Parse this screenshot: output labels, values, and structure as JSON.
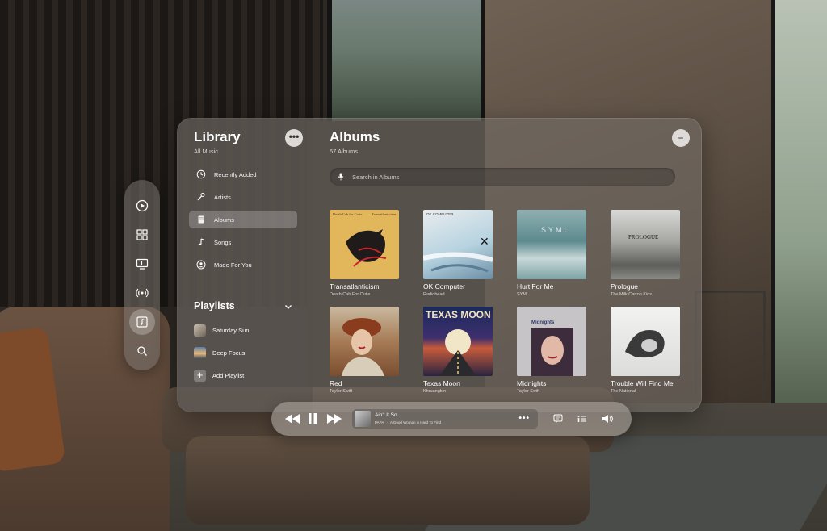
{
  "library": {
    "title": "Library",
    "subtitle": "All Music",
    "nav": [
      {
        "label": "Recently Added",
        "icon": "clock-icon"
      },
      {
        "label": "Artists",
        "icon": "microphone-icon"
      },
      {
        "label": "Albums",
        "icon": "album-icon",
        "active": true
      },
      {
        "label": "Songs",
        "icon": "music-note-icon"
      },
      {
        "label": "Made For You",
        "icon": "person-circle-icon"
      }
    ]
  },
  "playlists": {
    "title": "Playlists",
    "items": [
      {
        "label": "Saturday Sun"
      },
      {
        "label": "Deep Focus"
      },
      {
        "label": "Add Playlist"
      }
    ]
  },
  "albums": {
    "title": "Albums",
    "count": "57 Albums",
    "search_placeholder": "Search in Albums",
    "items": [
      {
        "title": "Transatlanticism",
        "artist": "Death Cab For Cutie",
        "cover_text": "Death Cab for Cutie",
        "cover_text2": "Transatlanticism"
      },
      {
        "title": "OK Computer",
        "artist": "Radiohead",
        "cover_text": "OK COMPUTER"
      },
      {
        "title": "Hurt For Me",
        "artist": "SYML",
        "cover_text": "SYML"
      },
      {
        "title": "Prologue",
        "artist": "The Milk Carton Kids",
        "cover_text": "PROLOGUE"
      },
      {
        "title": "Red",
        "artist": "Taylor Swift"
      },
      {
        "title": "Texas Moon",
        "artist": "Khruangbin",
        "cover_text": "TEXAS MOON"
      },
      {
        "title": "Midnights",
        "artist": "Taylor Swift",
        "cover_text": "Midnights"
      },
      {
        "title": "Trouble Will Find Me",
        "artist": "The National"
      }
    ]
  },
  "player": {
    "title": "Ain't It So",
    "artist": "PAPA",
    "album": "A Good Woman is Hard To Find",
    "more": "•••"
  },
  "colors": {
    "glass": "#736c66",
    "accent_white": "#ffffff"
  }
}
